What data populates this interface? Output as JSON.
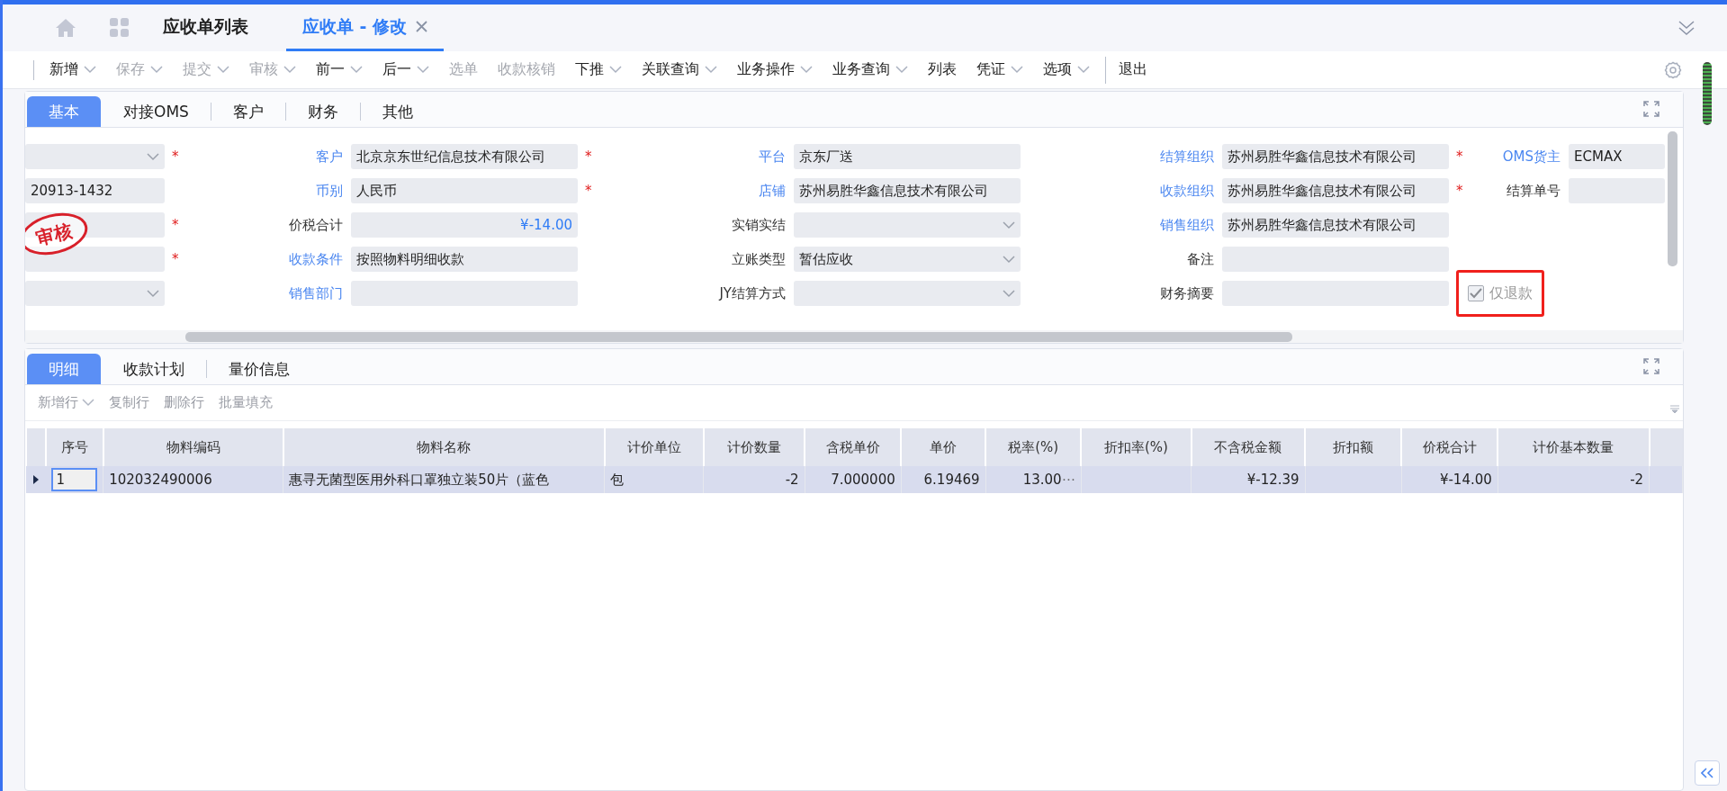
{
  "window_tabs": [
    {
      "label": "应收单列表",
      "selected": false,
      "closable": false
    },
    {
      "label": "应收单 - 修改",
      "selected": true,
      "closable": true
    }
  ],
  "toolbar": [
    {
      "label": "新增",
      "dropdown": true,
      "disabled": false,
      "separator_before": false
    },
    {
      "label": "保存",
      "dropdown": true,
      "disabled": true,
      "separator_before": false
    },
    {
      "label": "提交",
      "dropdown": true,
      "disabled": true,
      "separator_before": false
    },
    {
      "label": "审核",
      "dropdown": true,
      "disabled": true,
      "separator_before": false
    },
    {
      "label": "前一",
      "dropdown": true,
      "disabled": false,
      "separator_before": false
    },
    {
      "label": "后一",
      "dropdown": true,
      "disabled": false,
      "separator_before": false
    },
    {
      "label": "选单",
      "dropdown": false,
      "disabled": true,
      "separator_before": false
    },
    {
      "label": "收款核销",
      "dropdown": false,
      "disabled": true,
      "separator_before": false
    },
    {
      "label": "下推",
      "dropdown": true,
      "disabled": false,
      "separator_before": false
    },
    {
      "label": "关联查询",
      "dropdown": true,
      "disabled": false,
      "separator_before": false
    },
    {
      "label": "业务操作",
      "dropdown": true,
      "disabled": false,
      "separator_before": false
    },
    {
      "label": "业务查询",
      "dropdown": true,
      "disabled": false,
      "separator_before": false
    },
    {
      "label": "列表",
      "dropdown": false,
      "disabled": false,
      "separator_before": false
    },
    {
      "label": "凭证",
      "dropdown": true,
      "disabled": false,
      "separator_before": false
    },
    {
      "label": "选项",
      "dropdown": true,
      "disabled": false,
      "separator_before": false
    },
    {
      "label": "退出",
      "dropdown": false,
      "disabled": false,
      "separator_before": true
    }
  ],
  "header_tabs": [
    {
      "label": "基本",
      "selected": true
    },
    {
      "label": "对接OMS",
      "selected": false
    },
    {
      "label": "客户",
      "selected": false
    },
    {
      "label": "财务",
      "selected": false
    },
    {
      "label": "其他",
      "selected": false
    }
  ],
  "stamp": "审核",
  "form_rows": [
    [
      {
        "kind": "select",
        "required_mark": "*"
      },
      {
        "kind": "text",
        "label": "客户",
        "linked": true,
        "value": "北京京东世纪信息技术有限公司",
        "required_mark": "*"
      },
      {
        "kind": "text",
        "label": "平台",
        "linked": true,
        "value": "京东厂送"
      },
      {
        "kind": "text",
        "label": "结算组织",
        "linked": true,
        "value": "苏州易胜华鑫信息技术有限公司",
        "required_mark": "*"
      },
      {
        "kind": "text",
        "label": "OMS货主",
        "linked": true,
        "value": "ECMAX"
      }
    ],
    [
      {
        "kind": "text",
        "value": "20913-1432"
      },
      {
        "kind": "text",
        "label": "币别",
        "linked": true,
        "value": "人民币",
        "required_mark": "*"
      },
      {
        "kind": "text",
        "label": "店铺",
        "linked": true,
        "value": "苏州易胜华鑫信息技术有限公司"
      },
      {
        "kind": "text",
        "label": "收款组织",
        "linked": true,
        "value": "苏州易胜华鑫信息技术有限公司",
        "required_mark": "*"
      },
      {
        "kind": "text",
        "label": "结算单号",
        "linked": false
      }
    ],
    [
      {
        "kind": "text",
        "required_mark": "*"
      },
      {
        "kind": "amount",
        "label": "价税合计",
        "linked": false,
        "value": "¥-14.00"
      },
      {
        "kind": "select",
        "label": "实销实结",
        "linked": false
      },
      {
        "kind": "text",
        "label": "销售组织",
        "linked": true,
        "value": "苏州易胜华鑫信息技术有限公司"
      },
      {
        "kind": "none"
      }
    ],
    [
      {
        "kind": "text",
        "required_mark": "*"
      },
      {
        "kind": "text",
        "label": "收款条件",
        "linked": true,
        "value": "按照物料明细收款"
      },
      {
        "kind": "select",
        "label": "立账类型",
        "linked": false,
        "value": "暂估应收"
      },
      {
        "kind": "text",
        "label": "备注",
        "linked": false
      },
      {
        "kind": "none"
      }
    ],
    [
      {
        "kind": "select"
      },
      {
        "kind": "text",
        "label": "销售部门",
        "linked": true
      },
      {
        "kind": "select",
        "label": "JY结算方式",
        "linked": false
      },
      {
        "kind": "text",
        "label": "财务摘要",
        "linked": false
      },
      {
        "kind": "checkbox",
        "label": "仅退款",
        "checked": true,
        "highlighted": true
      }
    ]
  ],
  "detail_tabs": [
    {
      "label": "明细",
      "selected": true
    },
    {
      "label": "收款计划",
      "selected": false
    },
    {
      "label": "量价信息",
      "selected": false
    }
  ],
  "detail_toolbar": [
    {
      "label": "新增行",
      "dropdown": true
    },
    {
      "label": "复制行",
      "dropdown": false
    },
    {
      "label": "删除行",
      "dropdown": false
    },
    {
      "label": "批量填充",
      "dropdown": false
    }
  ],
  "table": {
    "columns": [
      "序号",
      "物料编码",
      "物料名称",
      "计价单位",
      "计价数量",
      "含税单价",
      "单价",
      "税率(%)",
      "折扣率(%)",
      "不含税金额",
      "折扣额",
      "价税合计",
      "计价基本数量"
    ],
    "rows": [
      {
        "selected": true,
        "cell_button": "⋯",
        "cells": [
          "1",
          "102032490006",
          "惠寻无菌型医用外科口罩独立装50片（蓝色",
          "包",
          "-2",
          "7.000000",
          "6.19469",
          "13.00",
          "",
          "¥-12.39",
          "",
          "¥-14.00",
          "-2"
        ]
      }
    ]
  }
}
